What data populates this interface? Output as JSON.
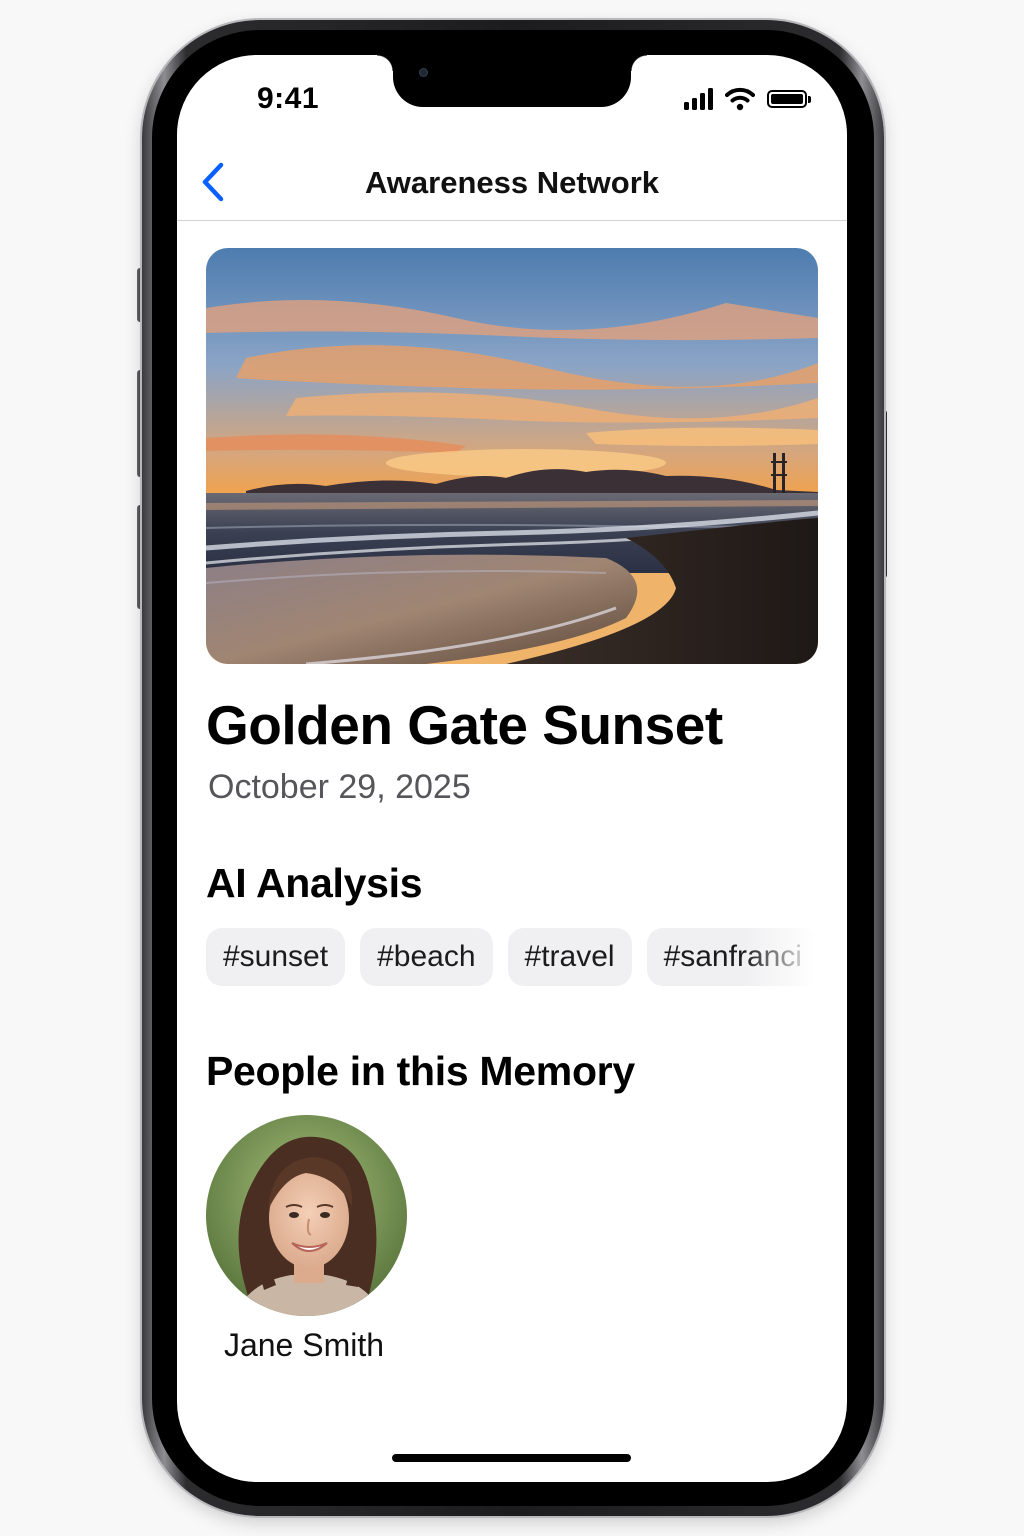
{
  "status_bar": {
    "time": "9:41",
    "icons": [
      "cellular-signal-icon",
      "wifi-icon",
      "battery-icon"
    ]
  },
  "nav": {
    "title": "Awareness Network",
    "back_icon": "chevron-left-icon"
  },
  "memory": {
    "photo": "sunset-beach-photo",
    "title": "Golden Gate Sunset",
    "date": "October 29, 2025"
  },
  "ai_analysis": {
    "heading": "AI Analysis",
    "tags": [
      "#sunset",
      "#beach",
      "#travel",
      "#sanfranci"
    ]
  },
  "people": {
    "heading": "People in this Memory",
    "items": [
      {
        "name": "Jane Smith",
        "avatar": "person-portrait"
      }
    ]
  },
  "colors": {
    "accent": "#0a60ff",
    "chip_background": "#f0f0f2",
    "secondary_text": "#55555a"
  }
}
